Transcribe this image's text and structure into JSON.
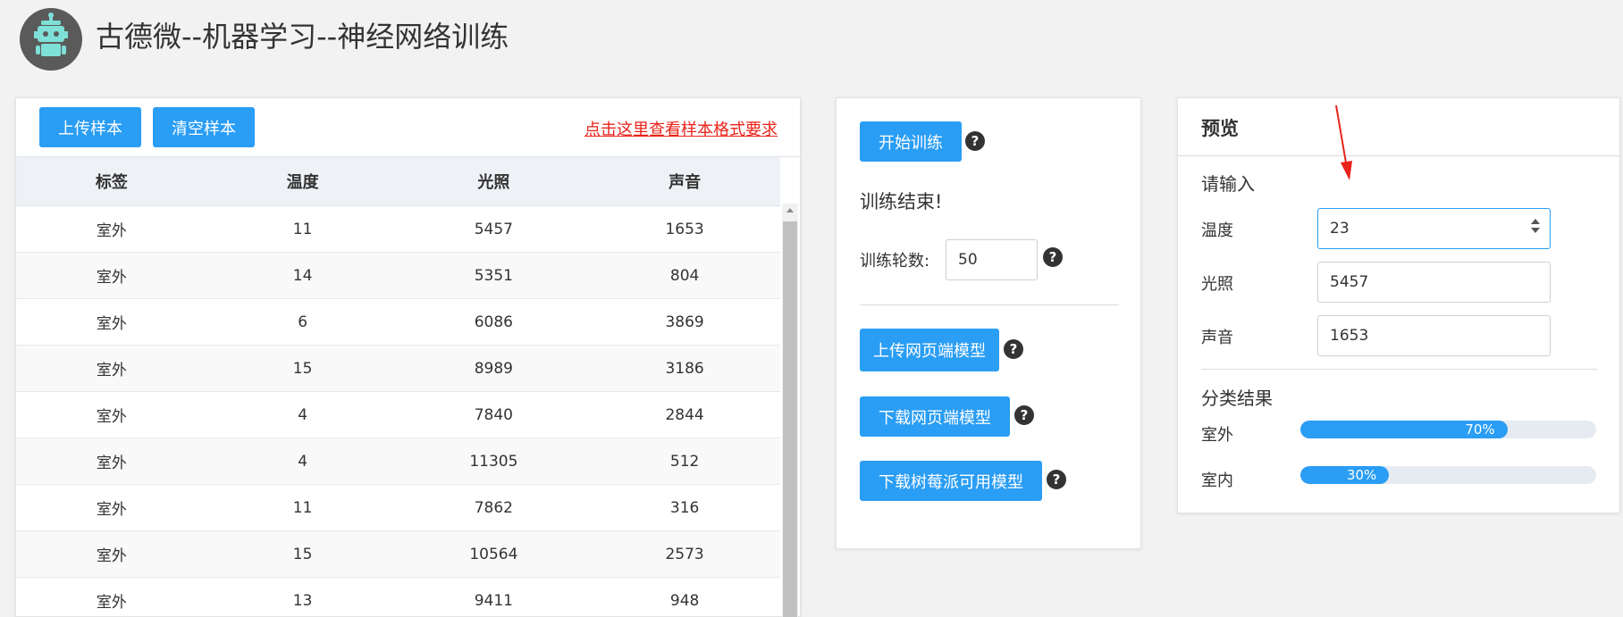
{
  "app": {
    "title": "古德微--机器学习--神经网络训练",
    "logo_icon": "robot-icon"
  },
  "colors": {
    "accent": "#2a9df4",
    "link": "#e8231a",
    "background": "#f2f2f2",
    "annotation": "#e8231a"
  },
  "samples_panel": {
    "upload_label": "上传样本",
    "clear_label": "清空样本",
    "format_link": "点击这里查看样本格式要求",
    "columns": [
      "标签",
      "温度",
      "光照",
      "声音"
    ],
    "rows": [
      [
        "室外",
        "11",
        "5457",
        "1653"
      ],
      [
        "室外",
        "14",
        "5351",
        "804"
      ],
      [
        "室外",
        "6",
        "6086",
        "3869"
      ],
      [
        "室外",
        "15",
        "8989",
        "3186"
      ],
      [
        "室外",
        "4",
        "7840",
        "2844"
      ],
      [
        "室外",
        "4",
        "11305",
        "512"
      ],
      [
        "室外",
        "11",
        "7862",
        "316"
      ],
      [
        "室外",
        "15",
        "10564",
        "2573"
      ],
      [
        "室外",
        "13",
        "9411",
        "948"
      ]
    ]
  },
  "training_panel": {
    "start_label": "开始训练",
    "status": "训练结束!",
    "epochs_label": "训练轮数:",
    "epochs_value": "50",
    "upload_model_label": "上传网页端模型",
    "download_model_label": "下载网页端模型",
    "download_pi_label": "下载树莓派可用模型",
    "help_glyph": "?"
  },
  "preview_panel": {
    "title": "预览",
    "input_heading": "请输入",
    "fields": [
      {
        "label": "温度",
        "value": "23"
      },
      {
        "label": "光照",
        "value": "5457"
      },
      {
        "label": "声音",
        "value": "1653"
      }
    ],
    "result_heading": "分类结果",
    "results": [
      {
        "label": "室外",
        "percent": 70,
        "text": "70%"
      },
      {
        "label": "室内",
        "percent": 30,
        "text": "30%"
      }
    ]
  }
}
